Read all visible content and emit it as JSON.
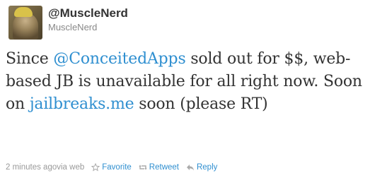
{
  "user": {
    "handle": "@MuscleNerd",
    "name": "MuscleNerd"
  },
  "tweet": {
    "text_1": "Since ",
    "mention": "@ConceitedApps",
    "text_2": " sold out for $$, web-based JB is unavailable for all right now. Soon on ",
    "link": "jailbreaks.me",
    "text_3": " soon (please RT)"
  },
  "meta": {
    "time": "2 minutes ago",
    "via": " via web"
  },
  "actions": {
    "favorite": "Favorite",
    "retweet": "Retweet",
    "reply": "Reply"
  },
  "colors": {
    "link": "#2f8fd0",
    "text": "#333333",
    "muted": "#999999"
  },
  "icons": [
    "star-icon",
    "retweet-icon",
    "reply-icon"
  ]
}
